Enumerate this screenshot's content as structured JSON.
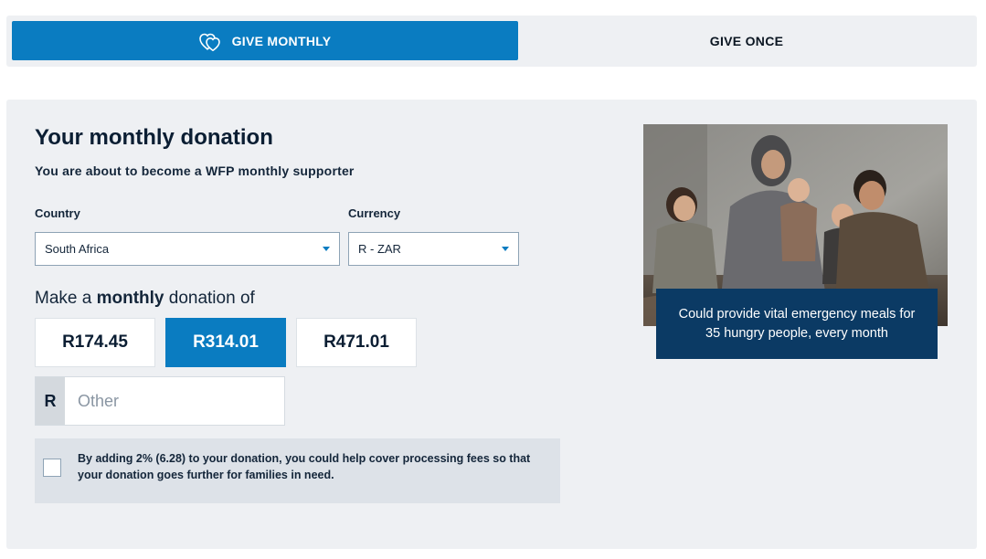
{
  "tabs": {
    "monthly_label": "GIVE MONTHLY",
    "monthly_icon": "hearts-icon",
    "once_label": "GIVE ONCE"
  },
  "form": {
    "title": "Your monthly donation",
    "subtitle": "You are about to become a WFP monthly supporter",
    "country_label": "Country",
    "country_value": "South Africa",
    "currency_label": "Currency",
    "currency_value": "R - ZAR",
    "make_prefix": "Make a ",
    "make_bold": "monthly",
    "make_suffix": " donation of",
    "amounts": [
      "R174.45",
      "R314.01",
      "R471.01"
    ],
    "selected_amount_index": 1,
    "other_prefix": "R",
    "other_placeholder": "Other",
    "fee_text": "By adding 2% (6.28) to your donation, you could help cover processing fees so that your donation goes further for families in need."
  },
  "photo": {
    "caption": "Could provide vital emergency meals for 35 hungry people, every month"
  },
  "colors": {
    "accent": "#0a7cc1",
    "caption_bg": "#0b3a64",
    "panel_bg": "#eef0f3"
  }
}
